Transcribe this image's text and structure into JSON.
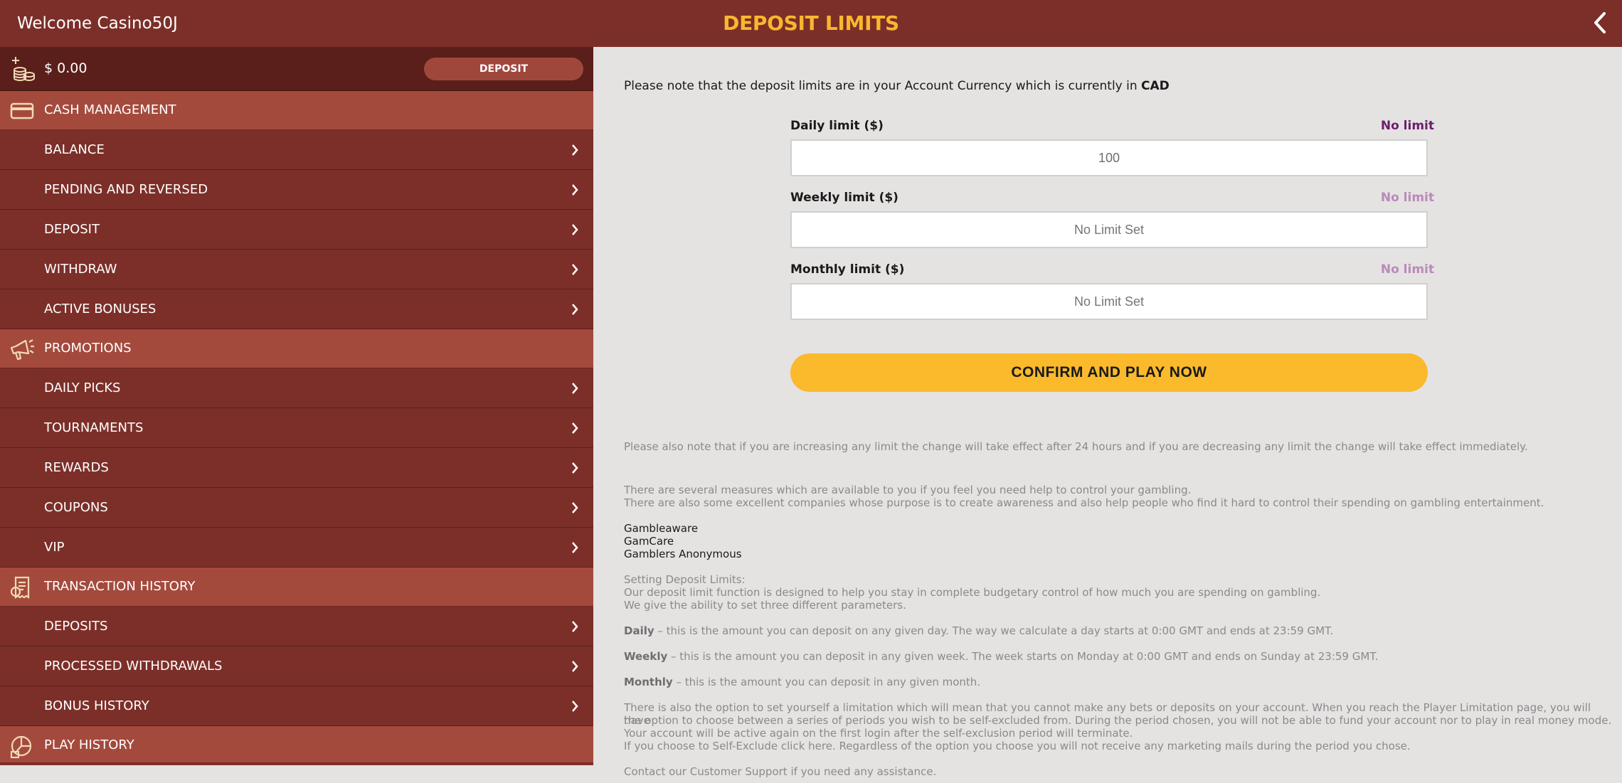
{
  "header": {
    "welcome": "Welcome Casino50J",
    "title": "DEPOSIT LIMITS",
    "back_icon": "chevron-left-icon"
  },
  "sidebar": {
    "balance": "$ 0.00",
    "deposit_label": "DEPOSIT",
    "sections": [
      {
        "label": "CASH MANAGEMENT",
        "icon": "card-icon",
        "items": [
          "BALANCE",
          "PENDING AND REVERSED",
          "DEPOSIT",
          "WITHDRAW",
          "ACTIVE BONUSES"
        ]
      },
      {
        "label": "PROMOTIONS",
        "icon": "megaphone-icon",
        "items": [
          "DAILY PICKS",
          "TOURNAMENTS",
          "REWARDS",
          "COUPONS",
          "VIP"
        ]
      },
      {
        "label": "TRANSACTION HISTORY",
        "icon": "receipt-icon",
        "items": [
          "DEPOSITS",
          "PROCESSED WITHDRAWALS",
          "BONUS HISTORY"
        ]
      },
      {
        "label": "PLAY HISTORY",
        "icon": "chart-icon",
        "items": []
      }
    ]
  },
  "main": {
    "currency_note_prefix": "Please note that the deposit limits are in your Account Currency which is currently in",
    "currency": "CAD",
    "limits": [
      {
        "label": "Daily limit ($)",
        "status": "No limit",
        "value": "100",
        "placeholder": ""
      },
      {
        "label": "Weekly limit ($)",
        "status": "No limit",
        "value": "",
        "placeholder": "No Limit Set"
      },
      {
        "label": "Monthly limit ($)",
        "status": "No limit",
        "value": "",
        "placeholder": "No Limit Set"
      }
    ],
    "confirm_label": "CONFIRM AND PLAY NOW",
    "info": {
      "change_note": "Please also note that if you are increasing any limit the change will take effect after 24 hours and if you are decreasing any limit the change will take effect immediately.",
      "measures_1": "There are several measures which are available to you if you feel you need help to control your gambling.",
      "measures_2": "There are also some excellent companies whose purpose is to create awareness and also help people who find it hard to control their spending on gambling entertainment.",
      "orgs": [
        "Gambleaware",
        "GamCare",
        "Gamblers Anonymous"
      ],
      "setting_title": "Setting Deposit Limits:",
      "setting_1": "Our deposit limit function is designed to help you stay in complete budgetary control of how much you are spending on gambling.",
      "setting_2": "We give the ability to set three different parameters.",
      "daily_term": "Daily",
      "daily_text": " – this is the amount you can deposit on any given day. The way we calculate a day starts at 0:00 GMT and ends at 23:59 GMT.",
      "weekly_term": "Weekly",
      "weekly_text": " – this is the amount you can deposit in any given week. The week starts on Monday at 0:00 GMT and ends on Sunday at 23:59 GMT.",
      "monthly_term": "Monthly",
      "monthly_text": " – this is the amount you can deposit in any given month.",
      "exclusion_1": "There is also the option to set yourself a limitation which will mean that you cannot make any bets or deposits on your account. When you reach the Player Limitation page, you will have",
      "exclusion_2": "the option to choose between a series of periods you wish to be self-excluded from. During the period chosen, you will not be able to fund your account nor to play in real money mode.",
      "exclusion_3": "Your account will be active again on the first login after the self-exclusion period will terminate.",
      "exclusion_4": "If you choose to Self-Exclude  click here. Regardless of the option you choose you will not receive any marketing mails during the period you chose.",
      "support": "Contact our Customer Support if you need any assistance."
    }
  },
  "colors": {
    "header_bg": "#7c2f29",
    "title": "#f9b72e",
    "section_bg": "#a44a3d",
    "nav_bg": "#7c2f29",
    "confirm_bg": "#fbb92c",
    "status_strong": "#6d1d6d",
    "status_faded": "#b98ab9"
  }
}
